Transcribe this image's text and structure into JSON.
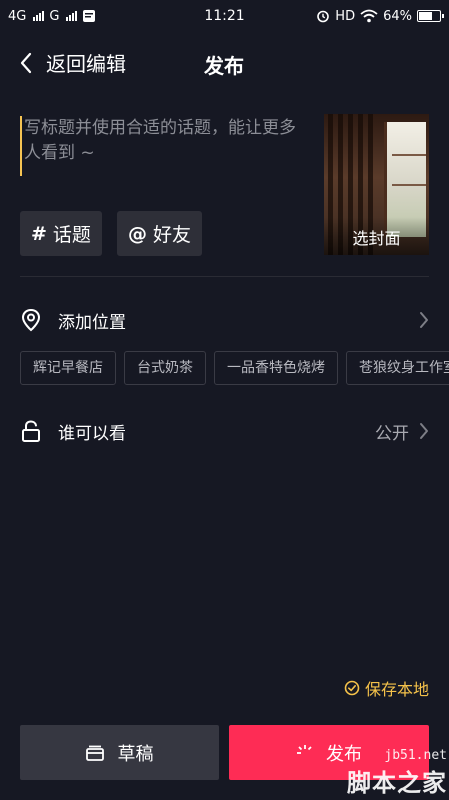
{
  "status_bar": {
    "network1": "4G",
    "network2": "G",
    "time": "11:21",
    "hd": "HD",
    "battery": "64%",
    "battery_level": 0.64
  },
  "nav": {
    "back_label": "返回编辑",
    "title": "发布"
  },
  "caption": {
    "placeholder": "写标题并使用合适的话题，能让更多人看到 ~"
  },
  "cover": {
    "label": "选封面"
  },
  "chips": {
    "topic_symbol": "#",
    "topic_label": "话题",
    "friend_symbol": "@",
    "friend_label": "好友"
  },
  "location": {
    "label": "添加位置",
    "suggestions": [
      "辉记早餐店",
      "台式奶茶",
      "一品香特色烧烤",
      "苍狼纹身工作室"
    ]
  },
  "visibility": {
    "label": "谁可以看",
    "value": "公开"
  },
  "save_local": {
    "label": "保存本地"
  },
  "buttons": {
    "draft_label": "草稿",
    "publish_label": "发布"
  },
  "watermark": {
    "url": "jb51.net",
    "name": "脚本之家"
  },
  "colors": {
    "background": "#161823",
    "accent_red": "#fe2c55",
    "accent_yellow": "#f5c24a"
  }
}
